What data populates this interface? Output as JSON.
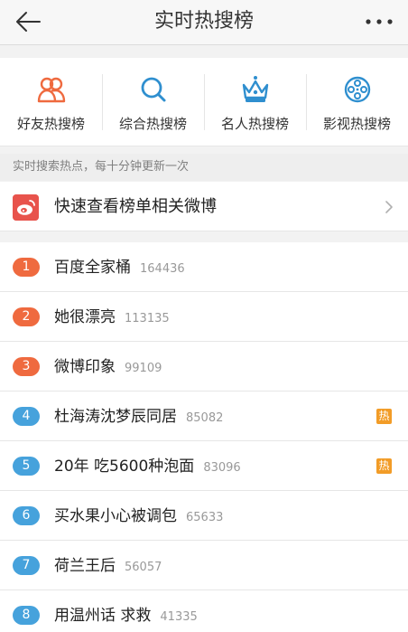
{
  "header": {
    "title": "实时热搜榜",
    "back_icon": "back-arrow-icon",
    "more_icon": "more-dots-icon"
  },
  "categories": [
    {
      "label": "好友热搜榜",
      "icon": "friends-icon",
      "color": "#ef6a3f"
    },
    {
      "label": "综合热搜榜",
      "icon": "search-icon",
      "color": "#2f8fcf"
    },
    {
      "label": "名人热搜榜",
      "icon": "crown-icon",
      "color": "#2f8fcf"
    },
    {
      "label": "影视热搜榜",
      "icon": "film-reel-icon",
      "color": "#2f8fcf"
    }
  ],
  "notice": "实时搜索热点，每十分钟更新一次",
  "quick": {
    "label": "快速查看榜单相关微博",
    "icon": "weibo-icon"
  },
  "list": [
    {
      "rank": "1",
      "title": "百度全家桶",
      "count": "164436",
      "hot": ""
    },
    {
      "rank": "2",
      "title": "她很漂亮",
      "count": "113135",
      "hot": ""
    },
    {
      "rank": "3",
      "title": "微博印象",
      "count": "99109",
      "hot": ""
    },
    {
      "rank": "4",
      "title": "杜海涛沈梦辰同居",
      "count": "85082",
      "hot": "热"
    },
    {
      "rank": "5",
      "title": "20年 吃5600种泡面",
      "count": "83096",
      "hot": "热"
    },
    {
      "rank": "6",
      "title": "买水果小心被调包",
      "count": "65633",
      "hot": ""
    },
    {
      "rank": "7",
      "title": "荷兰王后",
      "count": "56057",
      "hot": ""
    },
    {
      "rank": "8",
      "title": "用温州话 求救",
      "count": "41335",
      "hot": ""
    }
  ],
  "colors": {
    "top_rank": "#ef6a3f",
    "normal_rank": "#46a2dc",
    "hot_badge": "#f29c27",
    "weibo": "#e8534c"
  }
}
